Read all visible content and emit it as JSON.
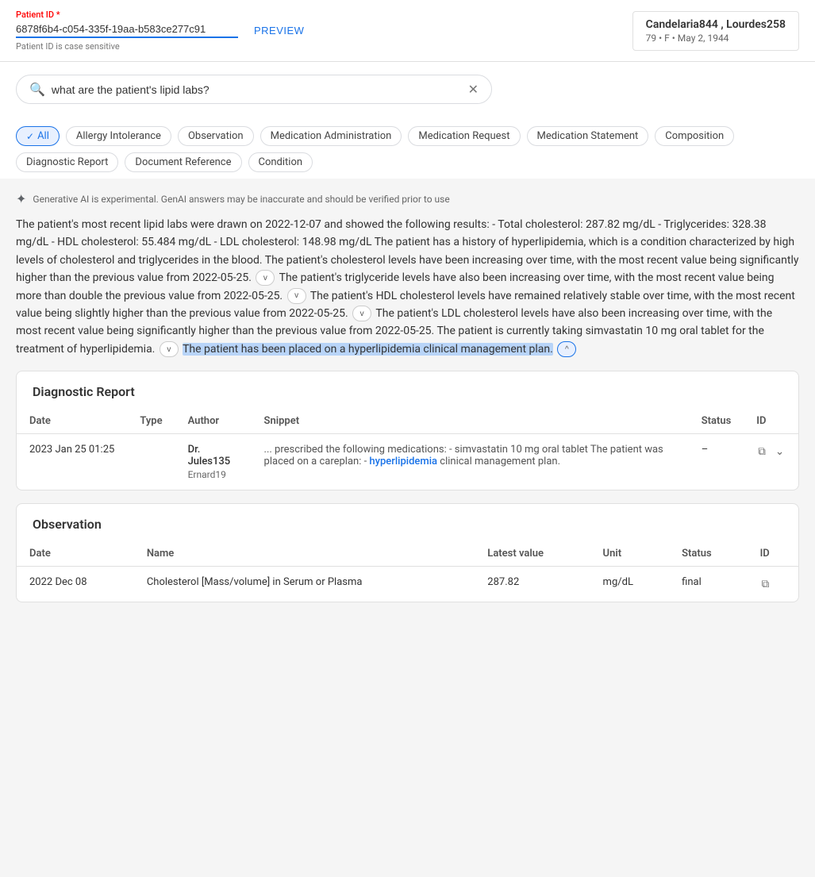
{
  "header": {
    "patient_id_label": "Patient ID",
    "patient_id_required": "*",
    "patient_id_value": "6878f6b4-c054-335f-19aa-b583ce277c91",
    "patient_id_hint": "Patient ID is case sensitive",
    "preview_btn": "PREVIEW",
    "patient_name": "Candelaria844 , Lourdes258",
    "patient_details": "79 • F • May 2, 1944"
  },
  "search": {
    "placeholder": "what are the patient's lipid labs?",
    "value": "what are the patient's lipid labs?",
    "clear_icon": "✕"
  },
  "filters": {
    "chips": [
      {
        "label": "All",
        "active": true
      },
      {
        "label": "Allergy Intolerance",
        "active": false
      },
      {
        "label": "Observation",
        "active": false
      },
      {
        "label": "Medication Administration",
        "active": false
      },
      {
        "label": "Medication Request",
        "active": false
      },
      {
        "label": "Medication Statement",
        "active": false
      },
      {
        "label": "Composition",
        "active": false
      },
      {
        "label": "Diagnostic Report",
        "active": false
      },
      {
        "label": "Document Reference",
        "active": false
      },
      {
        "label": "Condition",
        "active": false
      }
    ]
  },
  "ai_notice": "Generative AI is experimental. GenAI answers may be inaccurate and should be verified prior to use",
  "ai_response": {
    "text_before_expand1": "The patient's most recent lipid labs were drawn on 2022-12-07 and showed the following results: - Total cholesterol: 287.82 mg/dL - Triglycerides: 328.38 mg/dL - HDL cholesterol: 55.484 mg/dL - LDL cholesterol: 148.98 mg/dL The patient has a history of hyperlipidemia, which is a condition characterized by high levels of cholesterol and triglycerides in the blood. The patient's cholesterol levels have been increasing over time, with the most recent value being significantly higher than the previous value from 2022-05-25.",
    "text_before_expand2": "The patient's triglyceride levels have also been increasing over time, with the most recent value being more than double the previous value from 2022-05-25.",
    "text_before_expand3": "The patient's HDL cholesterol levels have remained relatively stable over time, with the most recent value being slightly higher than the previous value from 2022-05-25.",
    "text_before_expand4": "The patient's LDL cholesterol levels have also been increasing over time, with the most recent value being significantly higher than the previous value from 2022-05-25. The patient is currently taking simvastatin 10 mg oral tablet for the treatment of hyperlipidemia.",
    "highlighted_text": "The patient has been placed on a hyperlipidemia clinical management plan.",
    "expand_btns": [
      "v",
      "v",
      "v",
      "v",
      "^"
    ]
  },
  "diagnostic_report": {
    "title": "Diagnostic Report",
    "columns": [
      "Date",
      "Type",
      "Author",
      "Snippet",
      "Status",
      "ID"
    ],
    "rows": [
      {
        "date": "2023  Jan  25  01:25",
        "type": "",
        "author_name": "Dr. Jules135",
        "author_sub": "Ernard19",
        "snippet_before": "... prescribed the following medications: - simvastatin 10 mg oral tablet The patient was placed on a careplan: - ",
        "snippet_highlight": "hyperlipidemia",
        "snippet_after": " clinical management plan.",
        "status": "–",
        "id": "copy"
      }
    ]
  },
  "observation": {
    "title": "Observation",
    "columns": [
      "Date",
      "Name",
      "Latest value",
      "Unit",
      "Status",
      "ID"
    ],
    "rows": [
      {
        "date": "2022  Dec  08",
        "name": "Cholesterol [Mass/volume] in Serum or Plasma",
        "latest_value": "287.82",
        "unit": "mg/dL",
        "status": "final",
        "id": "copy"
      }
    ]
  },
  "icons": {
    "search": "🔍",
    "ai_star": "✦",
    "check": "✓",
    "copy": "⧉",
    "chevron_down": "⌄",
    "chevron_up": "⌃"
  }
}
